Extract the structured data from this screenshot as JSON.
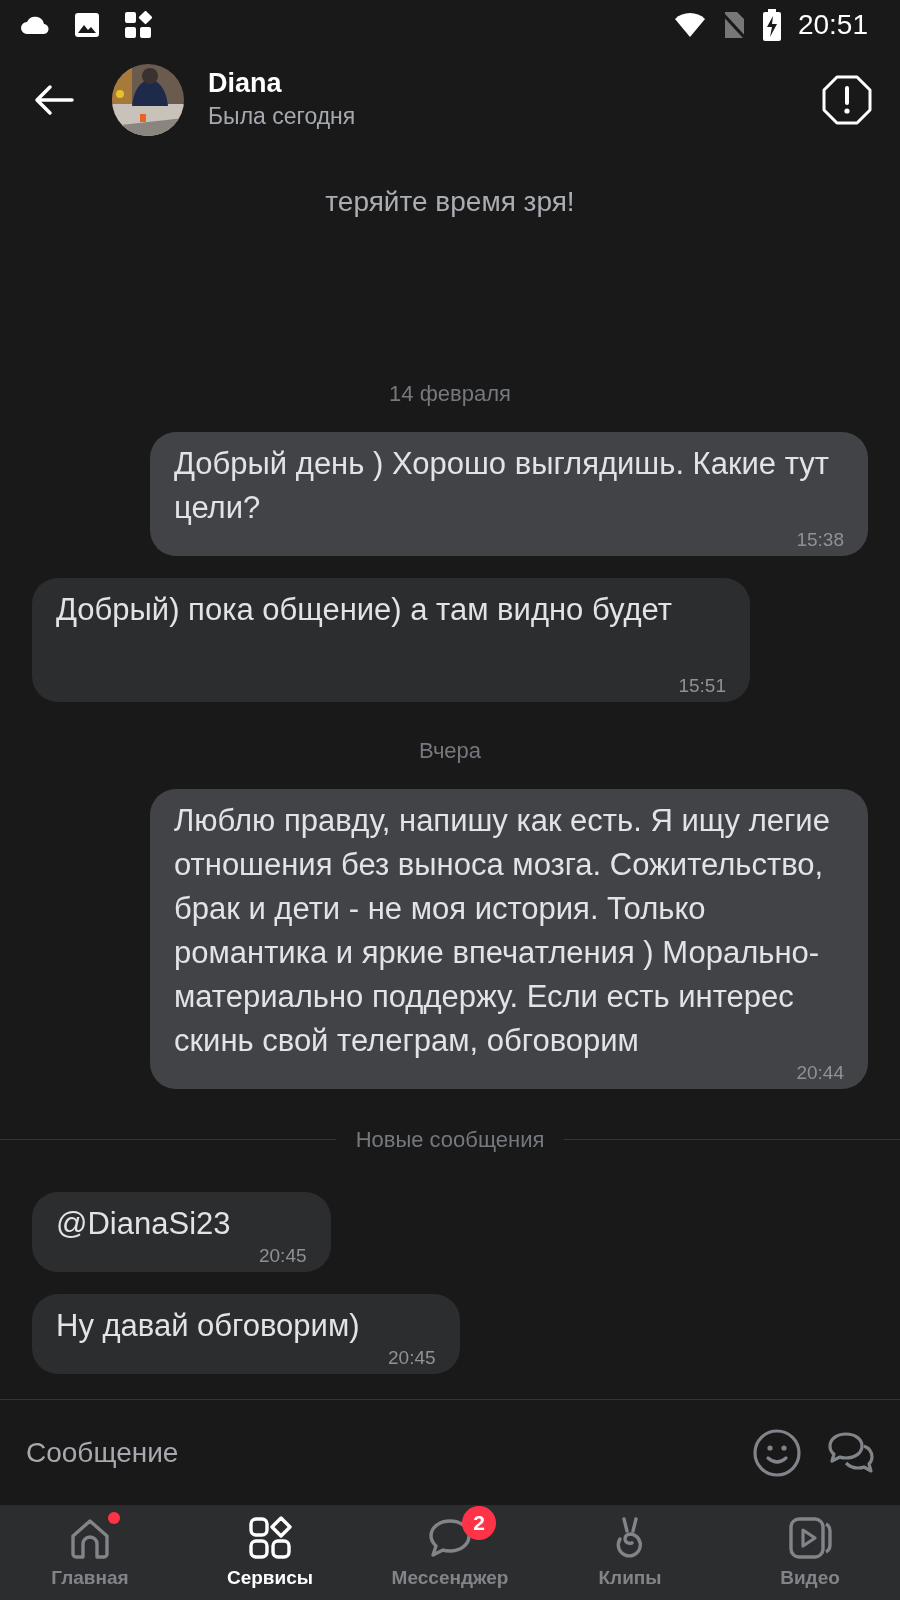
{
  "status_bar": {
    "time": "20:51"
  },
  "header": {
    "name": "Diana",
    "status": "Была сегодня"
  },
  "intro": "теряйте время зря!",
  "feed": [
    {
      "kind": "date",
      "text": "14 февраля"
    },
    {
      "kind": "message",
      "outgoing": true,
      "text": "Добрый день ) Хорошо выглядишь. Какие тут цели?",
      "time": "15:38"
    },
    {
      "kind": "message",
      "outgoing": false,
      "text": "Добрый) пока общение) а там видно будет",
      "time": "15:51"
    },
    {
      "kind": "date",
      "text": "Вчера"
    },
    {
      "kind": "message",
      "outgoing": true,
      "text": "Люблю правду, напишу как есть. Я ищу легие отношения без выноса мозга. Сожительство, брак и дети - не моя история. Только романтика и яркие впечатления ) Морально-материально поддержу. Если есть интерес скинь свой телеграм, обговорим",
      "time": "20:44"
    },
    {
      "kind": "divider",
      "text": "Новые сообщения"
    },
    {
      "kind": "message",
      "outgoing": false,
      "text": "@DianaSi23",
      "time": "20:45"
    },
    {
      "kind": "message",
      "outgoing": false,
      "text": "Ну давай обговорим)",
      "time": "20:45"
    }
  ],
  "composer": {
    "placeholder": "Сообщение"
  },
  "nav": [
    {
      "label": "Главная",
      "kind": "home",
      "selected": false,
      "dot": true
    },
    {
      "label": "Сервисы",
      "kind": "services",
      "selected": true,
      "dot": false
    },
    {
      "label": "Мессенджер",
      "kind": "chat",
      "selected": false,
      "dot": false,
      "badge": "2"
    },
    {
      "label": "Клипы",
      "kind": "clips",
      "selected": false,
      "dot": false
    },
    {
      "label": "Видео",
      "kind": "video",
      "selected": false,
      "dot": false
    }
  ]
}
